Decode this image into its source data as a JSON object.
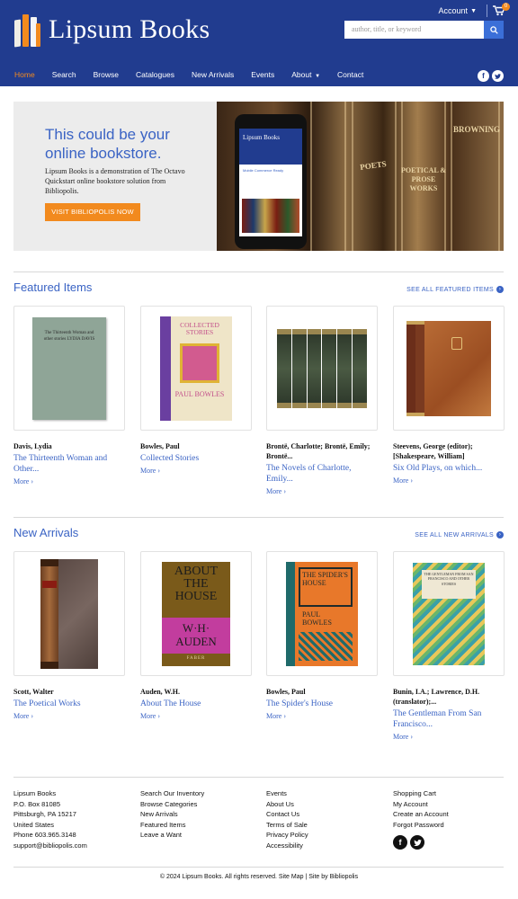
{
  "brand": {
    "name": "Lipsum Books"
  },
  "header": {
    "account_label": "Account",
    "cart_count": "0",
    "search_placeholder": "author, title, or keyword"
  },
  "nav": {
    "items": [
      "Home",
      "Search",
      "Browse",
      "Catalogues",
      "New Arrivals",
      "Events",
      "About",
      "Contact"
    ],
    "active": "Home"
  },
  "hero": {
    "title": "This could be your online bookstore.",
    "text": "Lipsum Books is a demonstration of The Octavo Quickstart online bookstore solution from Bibliopolis.",
    "button": "VISIT BIBLIOPOLIS NOW",
    "phone_brand": "Lipsum Books",
    "phone_text": "Mobile Commerce Ready",
    "spine_labels": [
      "POETS",
      "POETICAL & PROSE WORKS",
      "BROWNING"
    ]
  },
  "featured": {
    "title": "Featured Items",
    "see_all": "SEE ALL FEATURED ITEMS",
    "items": [
      {
        "author": "Davis, Lydia",
        "title": "The Thirteenth Woman and Other...",
        "more": "More ›",
        "cover": "The Thirteenth Woman and other stories LYDIA DAVIS"
      },
      {
        "author": "Bowles, Paul",
        "title": "Collected Stories",
        "more": "More ›",
        "cover_top": "COLLECTED STORIES",
        "cover_bottom": "PAUL BOWLES"
      },
      {
        "author": "Brontë, Charlotte; Brontë, Emily; Brontë...",
        "title": "The Novels of Charlotte, Emily...",
        "more": "More ›"
      },
      {
        "author": "Steevens, George (editor); [Shakespeare, William]",
        "title": "Six Old Plays, on which...",
        "more": "More ›"
      }
    ]
  },
  "new_arrivals": {
    "title": "New Arrivals",
    "see_all": "SEE ALL NEW ARRIVALS",
    "items": [
      {
        "author": "Scott, Walter",
        "title": "The Poetical Works",
        "more": "More ›"
      },
      {
        "author": "Auden, W.H.",
        "title": "About The House",
        "more": "More ›",
        "cover_top": "ABOUT THE HOUSE",
        "cover_bottom": "W·H· AUDEN",
        "cover_pub": "FABER"
      },
      {
        "author": "Bowles, Paul",
        "title": "The Spider's House",
        "more": "More ›",
        "cover_top": "THE SPIDER'S HOUSE",
        "cover_bottom": "PAUL BOWLES"
      },
      {
        "author": "Bunin, I.A.; Lawrence, D.H. (translator);...",
        "title": "The Gentleman From San Francisco...",
        "more": "More ›",
        "cover": "THE GENTLEMAN FROM SAN FRANCISCO AND OTHER STORIES"
      }
    ]
  },
  "footer": {
    "col1": [
      "Lipsum Books",
      "P.O. Box 81085",
      "Pittsburgh, PA 15217",
      "United States",
      "Phone 603.965.3148",
      "support@bibliopolis.com"
    ],
    "col2": [
      "Search Our Inventory",
      "Browse Categories",
      "New Arrivals",
      "Featured Items",
      "Leave a Want"
    ],
    "col3": [
      "Events",
      "About Us",
      "Contact Us",
      "Terms of Sale",
      "Privacy Policy",
      "Accessibility"
    ],
    "col4": [
      "Shopping Cart",
      "My Account",
      "Create an Account",
      "Forgot Password"
    ],
    "copyright": "© 2024 Lipsum Books. All rights reserved. Site Map | Site by Bibliopolis"
  },
  "colors": {
    "header_bg": "#213c8f",
    "accent": "#f28a1e",
    "link": "#3a63c4"
  }
}
